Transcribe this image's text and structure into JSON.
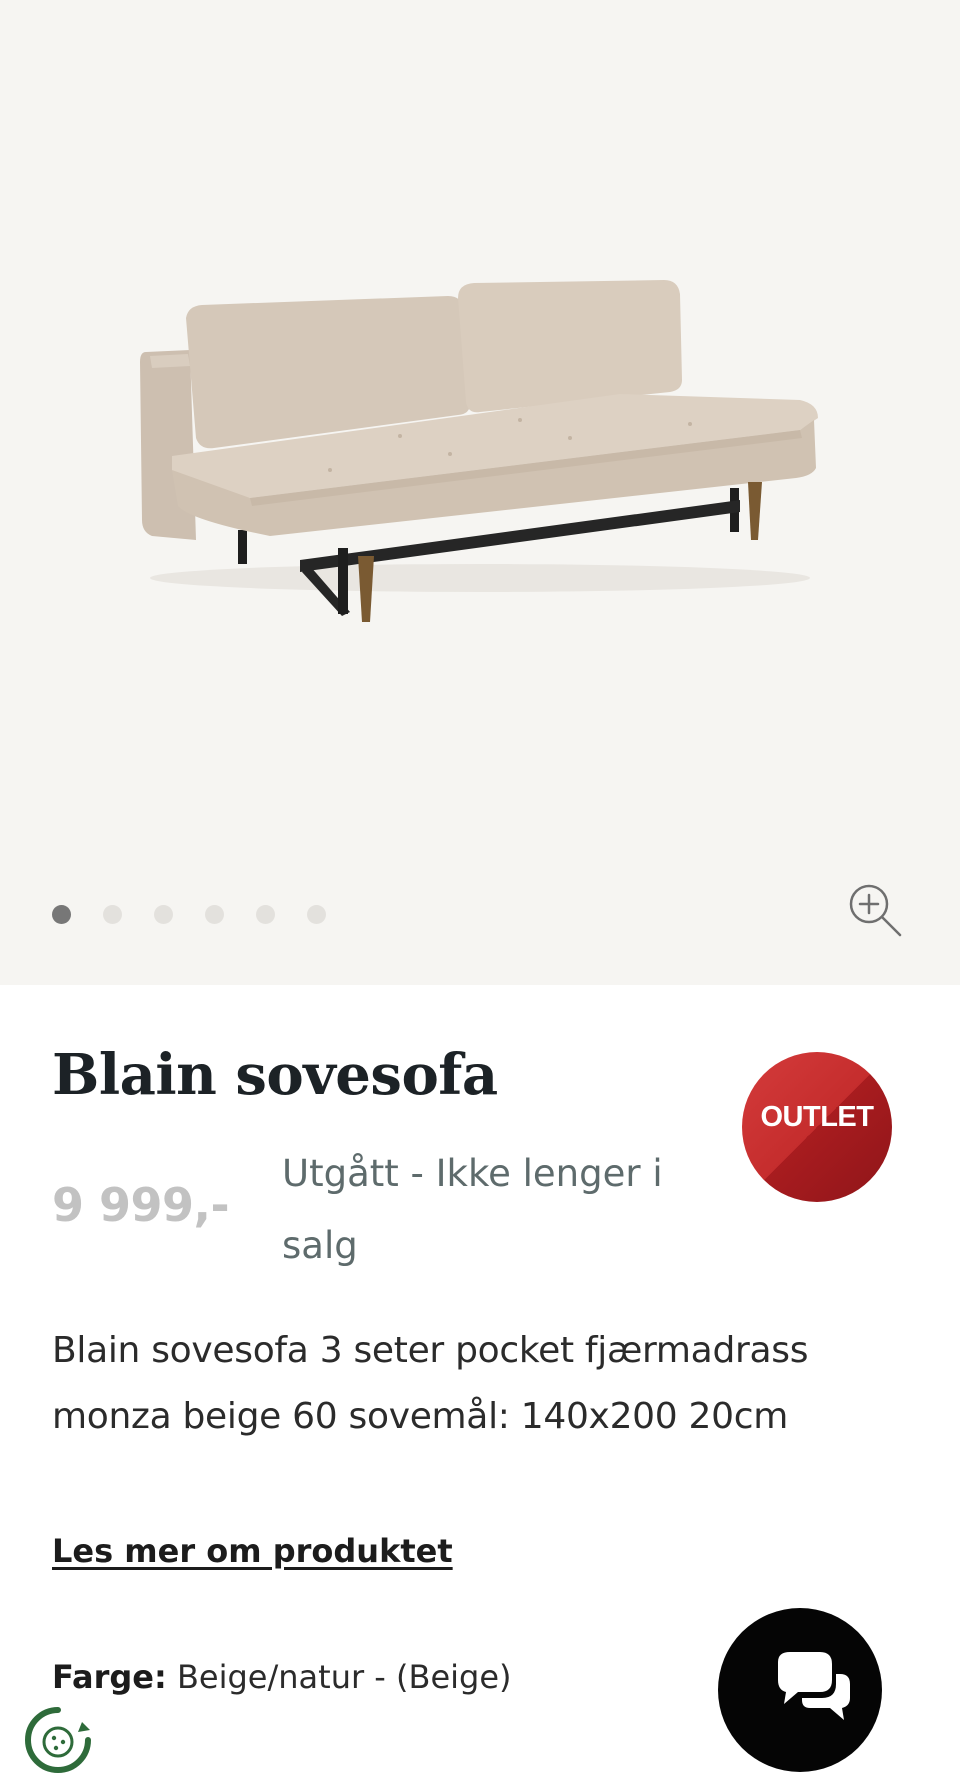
{
  "gallery": {
    "image_alt": "Blain sovesofa beige",
    "slide_count": 6,
    "active_slide": 1,
    "zoom_icon": "zoom-in-icon"
  },
  "product": {
    "title": "Blain sovesofa",
    "price": "9 999,-",
    "status": "Utgått - Ikke lenger i salg",
    "badge": "OUTLET",
    "description": "Blain sovesofa 3 seter pocket fjærmadrass monza beige 60 sovemål: 140x200 20cm",
    "read_more": "Les mer om produktet",
    "color_label": "Farge:",
    "color_value": "Beige/natur - (Beige)"
  },
  "widgets": {
    "chat_icon": "chat-bubbles-icon",
    "cookie_icon": "cookie-settings-icon"
  },
  "colors": {
    "gallery_bg": "#f6f5f2",
    "sofa_fabric": "#d8cabb",
    "badge_red": "#c52d2d",
    "price_grey": "#c2c2c2",
    "status_grey": "#5e6b6c",
    "title_dark": "#1c2226",
    "cookie_green": "#2e6b3a"
  }
}
